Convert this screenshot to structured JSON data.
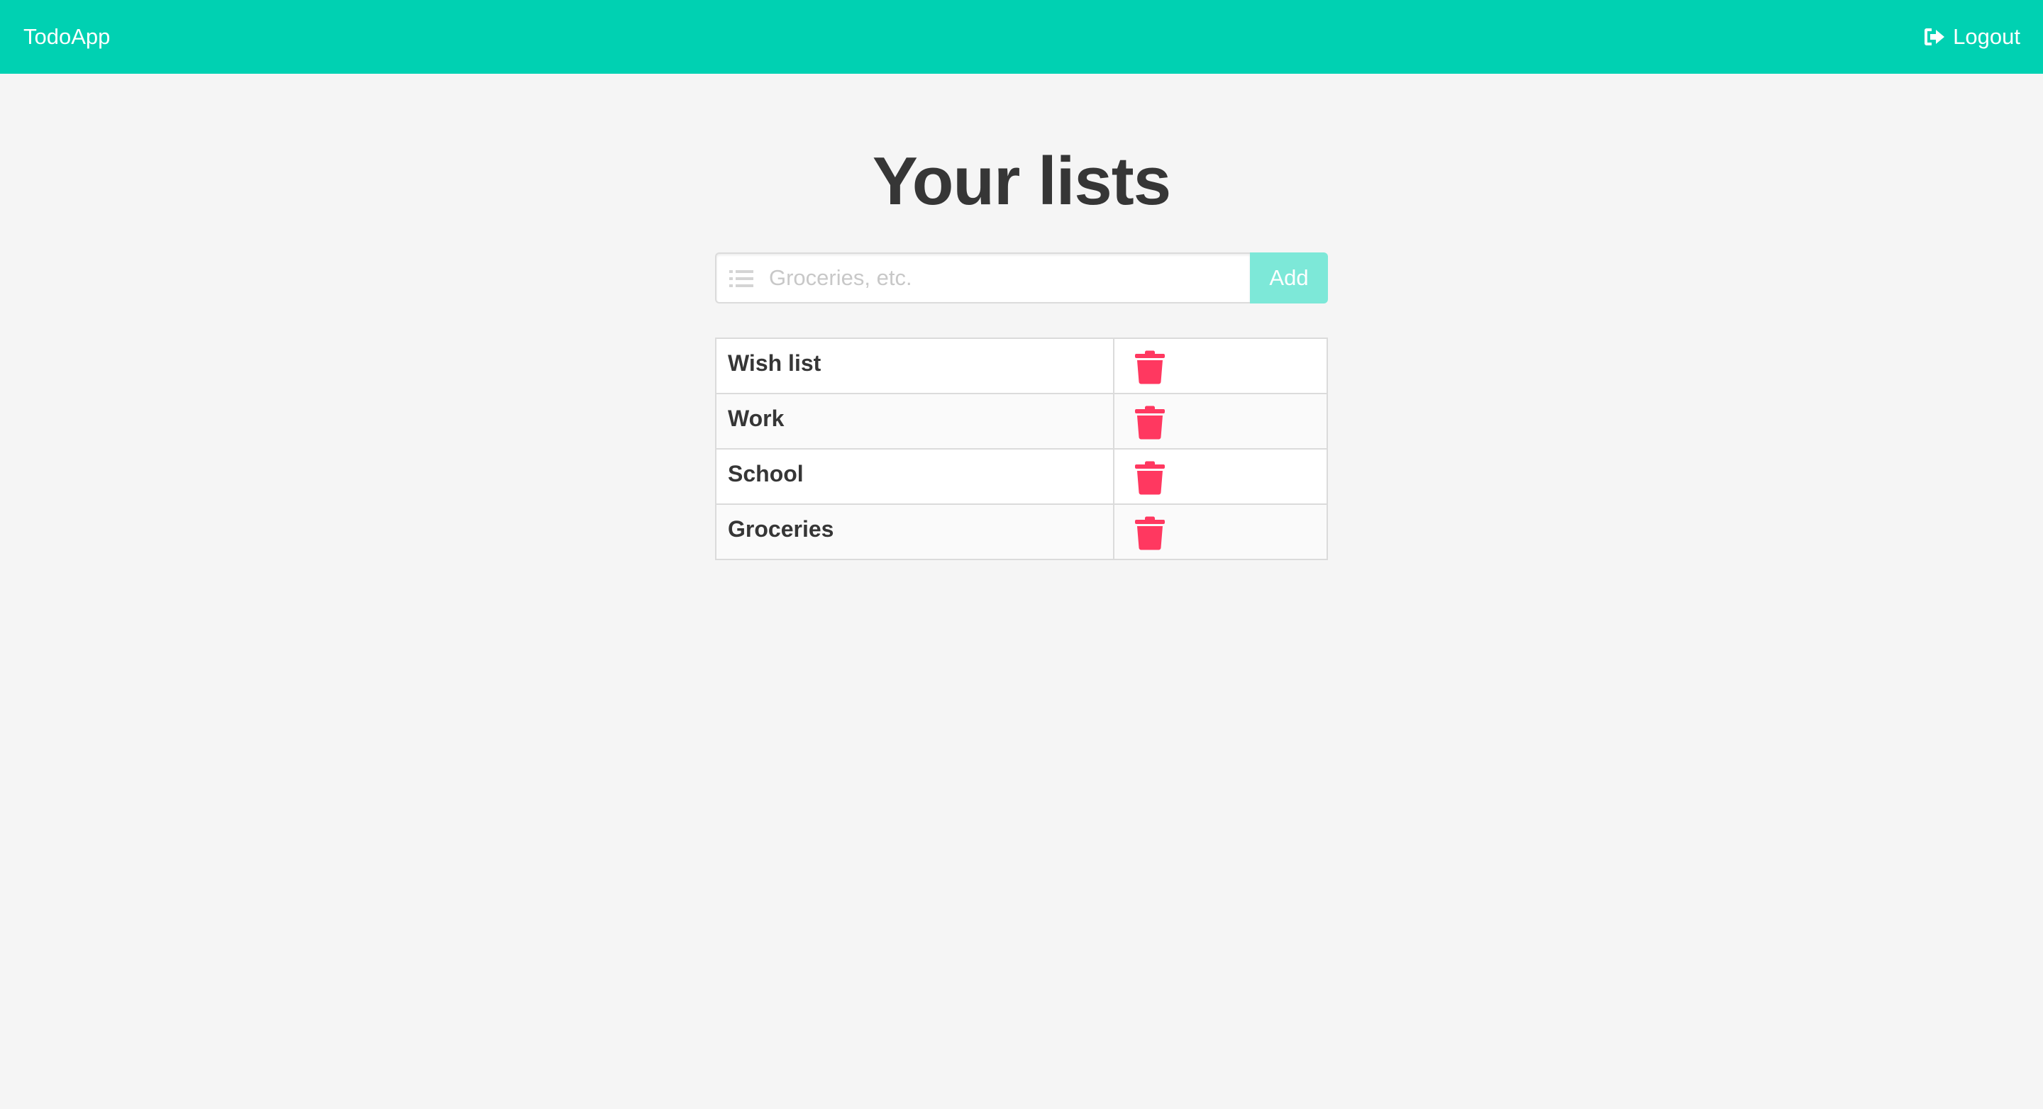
{
  "navbar": {
    "brand": "TodoApp",
    "logout_label": "Logout",
    "logout_icon": "sign-out-icon",
    "background_color": "#00d1b2"
  },
  "main": {
    "title": "Your lists",
    "add_form": {
      "input_icon": "list-icon",
      "placeholder": "Groceries, etc.",
      "value": "",
      "add_label": "Add"
    },
    "lists": [
      {
        "name": "Wish list",
        "delete_icon": "trash-icon"
      },
      {
        "name": "Work",
        "delete_icon": "trash-icon"
      },
      {
        "name": "School",
        "delete_icon": "trash-icon"
      },
      {
        "name": "Groceries",
        "delete_icon": "trash-icon"
      }
    ],
    "delete_color": "#ff3860"
  }
}
